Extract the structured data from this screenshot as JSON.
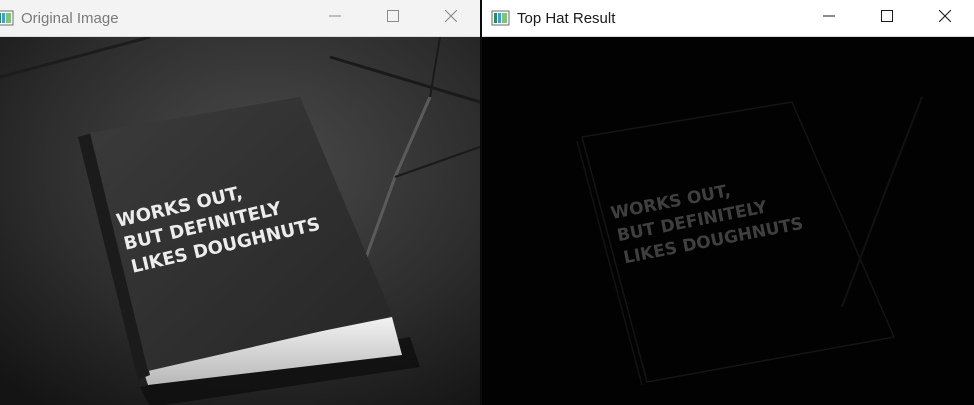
{
  "windows": {
    "left": {
      "title": "Original Image"
    },
    "right": {
      "title": "Top Hat Result"
    }
  },
  "book": {
    "line1": "WORKS OUT,",
    "line2": "BUT DEFINITELY",
    "line3": "LIKES DOUGHNUTS"
  },
  "icons": {
    "app": "image-viewer-icon",
    "minimize": "minimize-icon",
    "maximize": "maximize-icon",
    "close": "close-icon"
  }
}
